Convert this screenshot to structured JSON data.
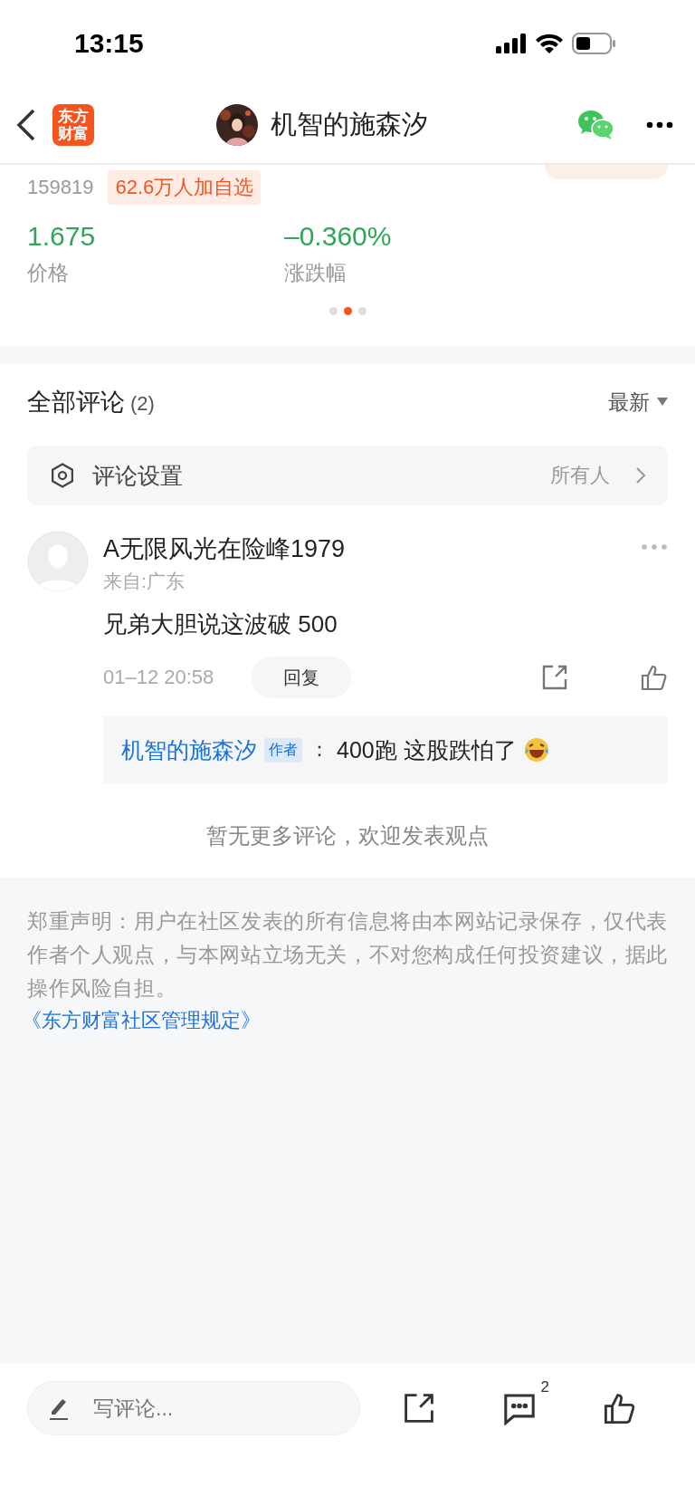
{
  "status_bar": {
    "time": "13:15"
  },
  "nav": {
    "logo": "东方财富",
    "title": "机智的施森汐"
  },
  "stock": {
    "code": "159819",
    "followers": "62.6万人加自选",
    "metrics": [
      {
        "value": "1.675",
        "label": "价格"
      },
      {
        "value": "–0.360%",
        "label": "涨跌幅"
      }
    ],
    "pages": [
      {
        "selected": false
      },
      {
        "selected": true
      },
      {
        "selected": false
      }
    ]
  },
  "comments": {
    "title": "全部评论",
    "count": "(2)",
    "sort": "最新",
    "settings": {
      "label": "评论设置",
      "value": "所有人"
    },
    "items": [
      {
        "user": "A无限风光在险峰1979",
        "location": "来自:广东",
        "text": "兄弟大胆说这波破 500",
        "time": "01–12 20:58",
        "reply_button": "回复",
        "replies": [
          {
            "user": "机智的施森汐",
            "badge": "作者",
            "separator": "：",
            "text": "400跑 这股跌怕了"
          }
        ]
      }
    ],
    "end_note": "暂无更多评论，欢迎发表观点"
  },
  "disclaimer": {
    "text": "郑重声明：用户在社区发表的所有信息将由本网站记录保存，仅代表作者个人观点，与本网站立场无关，不对您构成任何投资建议，据此操作风险自担。",
    "link": "《东方财富社区管理规定》"
  },
  "bottom_bar": {
    "placeholder": "写评论...",
    "comment_count": "2"
  }
}
